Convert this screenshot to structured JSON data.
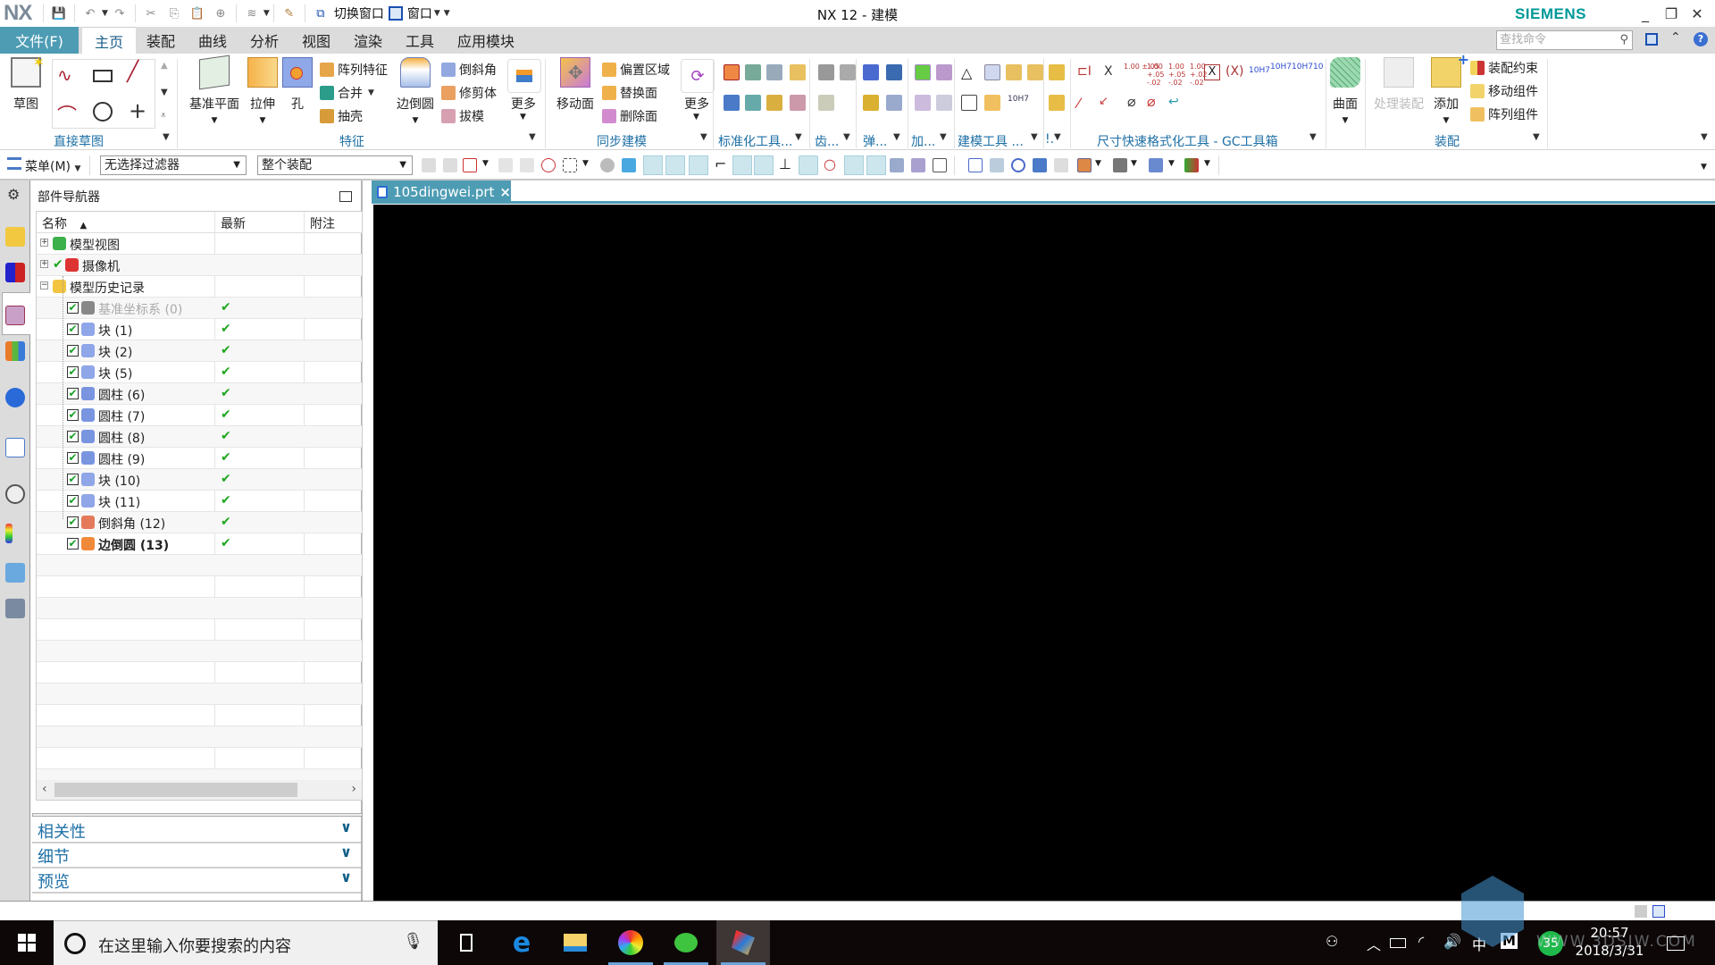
{
  "window": {
    "app_logo": "NX",
    "title": "NX 12 - 建模",
    "brand": "SIEMENS",
    "minimize": "_",
    "restore": "❐",
    "close": "✕"
  },
  "quick_access": {
    "switch_window": "切换窗口",
    "window": "窗口"
  },
  "menu_tabs": {
    "file": "文件(F)",
    "items": [
      "主页",
      "装配",
      "曲线",
      "分析",
      "视图",
      "渲染",
      "工具",
      "应用模块"
    ],
    "active": "主页",
    "search_placeholder": "查找命令"
  },
  "ribbon": {
    "sketch": "草图",
    "direct_sketch_group": "直接草图",
    "datum_plane": "基准平面",
    "extrude": "拉伸",
    "hole": "孔",
    "pattern_feature": "阵列特征",
    "unite": "合并",
    "shell": "抽壳",
    "edge_blend": "边倒圆",
    "chamfer": "倒斜角",
    "trim_body": "修剪体",
    "draft": "拔模",
    "more1": "更多",
    "feature_group": "特征",
    "move_face": "移动面",
    "offset_region": "偏置区域",
    "replace_face": "替换面",
    "delete_face": "删除面",
    "more2": "更多",
    "sync_group": "同步建模",
    "std_tools_group": "标准化工具...",
    "gear_group": "齿...",
    "spring_group": "弹...",
    "add_group": "加...",
    "model_tools_group": "建模工具 ...",
    "misc_group": "!.",
    "dim_group": "尺寸快速格式化工具 - GC工具箱",
    "dim_labels": [
      "1.00 ±.05",
      "1.00 +.05 -.02",
      "1.00 +.05 -.02",
      "1.00 +.02 -.02",
      "10H7",
      "10H7",
      "10H7",
      "10"
    ],
    "surface": "曲面",
    "process_assembly": "处理装配",
    "add_component": "添加",
    "assembly_constraint": "装配约束",
    "move_component": "移动组件",
    "pattern_component": "阵列组件",
    "assembly_group": "装配"
  },
  "toolbar": {
    "menu": "菜单(M)",
    "filter": "无选择过滤器",
    "scope": "整个装配"
  },
  "navigator": {
    "title": "部件导航器",
    "columns": [
      "名称",
      "最新",
      "附注"
    ],
    "nodes": [
      {
        "label": "模型视图",
        "level": 0,
        "expander": "+",
        "icon": "model-views-icon",
        "latest": ""
      },
      {
        "label": "摄像机",
        "level": 0,
        "expander": "+",
        "icon": "camera-icon",
        "latest": "",
        "checked_mark": "✔"
      },
      {
        "label": "模型历史记录",
        "level": 0,
        "expander": "−",
        "icon": "folder-open-icon",
        "latest": ""
      },
      {
        "label": "基准坐标系 (0)",
        "level": 1,
        "icon": "datum-csys-icon",
        "latest": "✔",
        "dimmed": true
      },
      {
        "label": "块 (1)",
        "level": 1,
        "icon": "block-icon",
        "latest": "✔"
      },
      {
        "label": "块 (2)",
        "level": 1,
        "icon": "block-icon",
        "latest": "✔"
      },
      {
        "label": "块 (5)",
        "level": 1,
        "icon": "block-icon",
        "latest": "✔"
      },
      {
        "label": "圆柱 (6)",
        "level": 1,
        "icon": "cylinder-icon",
        "latest": "✔"
      },
      {
        "label": "圆柱 (7)",
        "level": 1,
        "icon": "cylinder-icon",
        "latest": "✔"
      },
      {
        "label": "圆柱 (8)",
        "level": 1,
        "icon": "cylinder-icon",
        "latest": "✔"
      },
      {
        "label": "圆柱 (9)",
        "level": 1,
        "icon": "cylinder-icon",
        "latest": "✔"
      },
      {
        "label": "块 (10)",
        "level": 1,
        "icon": "block-icon",
        "latest": "✔"
      },
      {
        "label": "块 (11)",
        "level": 1,
        "icon": "block-icon",
        "latest": "✔"
      },
      {
        "label": "倒斜角 (12)",
        "level": 1,
        "icon": "chamfer-icon",
        "latest": "✔"
      },
      {
        "label": "边倒圆 (13)",
        "level": 1,
        "icon": "edge-blend-icon",
        "latest": "✔",
        "bold": true
      }
    ],
    "panels": [
      "相关性",
      "细节",
      "预览"
    ]
  },
  "document": {
    "tab": "105dingwei.prt",
    "close": "×"
  },
  "taskbar": {
    "search_placeholder": "在这里输入你要搜索的内容",
    "tray_ime": "中",
    "tray_badge": "35",
    "time": "20:57",
    "date": "2018/3/31"
  },
  "watermark": "WWW.3DSJW.COM"
}
